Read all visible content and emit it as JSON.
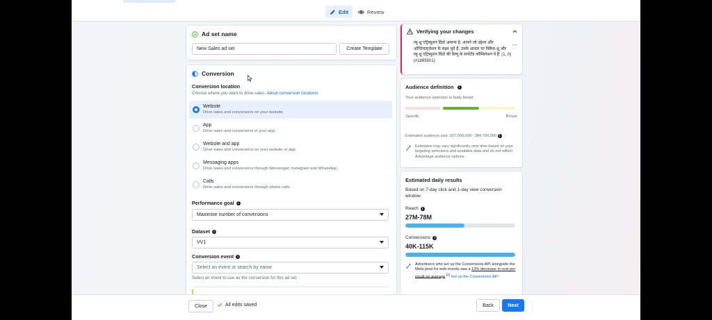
{
  "tabs": {
    "edit": "Edit",
    "review": "Review"
  },
  "ad_set": {
    "title": "Ad set name",
    "name_value": "New Sales ad set",
    "create_template": "Create Template"
  },
  "conversion": {
    "title": "Conversion",
    "location_label": "Conversion location",
    "location_help": "Choose where you want to drive sales.",
    "location_link": "About conversion locations",
    "options": [
      {
        "title": "Website",
        "desc": "Drive sales and conversions on your website."
      },
      {
        "title": "App",
        "desc": "Drive sales and conversions in your app."
      },
      {
        "title": "Website and app",
        "desc": "Drive sales and conversions on your website or app."
      },
      {
        "title": "Messaging apps",
        "desc": "Drive sales and conversions through Messenger, Instagram and WhatsApp."
      },
      {
        "title": "Calls",
        "desc": "Drive sales and conversions through phone calls."
      }
    ],
    "selected_option": "Website",
    "performance_goal_label": "Performance goal",
    "performance_goal_value": "Maximise number of conversions",
    "dataset_label": "Dataset",
    "dataset_value": "VV1",
    "event_label": "Conversion event",
    "event_placeholder": "Select an event or search by name",
    "event_help": "Select an event to use as the conversion for this ad set."
  },
  "verify": {
    "title": "Verifying your changes",
    "message": "व्यू-थ्रू एट्रिब्यूशन विंडो अमान्य है: आपने जो उद्देश्य और ऑप्टिमाइज़ेशन के लक्ष्य चुने हैं, उनके आधार पर क्लिक-थ्रू और व्यू-थ्रू एट्रिब्यूशन विंडो की वैल्यू के सपोर्टेड कॉम्बिनेशन ये हैं: (1, 0) (#1885501)",
    "more": "···",
    "accent": "#e0245e"
  },
  "audience": {
    "title": "Audience definition",
    "status": "Your audience selection is fairly broad.",
    "specific": "Specific",
    "broad": "Broad",
    "size_label": "Estimated audience size: 327,000,000 - 384,700,000",
    "note": "Estimates may vary significantly over time based on your targeting selections and available data and do not reflect Advantage audience options."
  },
  "daily": {
    "title": "Estimated daily results",
    "basis": "Based on 7-day click and 1-day view conversion window",
    "reach_label": "Reach",
    "reach_value": "27M-78M",
    "reach_fill": 0.54,
    "conv_label": "Conversions",
    "conv_value": "40K-115K",
    "conv_fill": 1.0,
    "tip_text": "Advertisers who set up the Conversions API alongside the Meta pixel for web events saw a",
    "tip_link1": "13% decrease in cost per result on average",
    "tip_sup": "[1]",
    "tip_link2": "Set up the Conversions API"
  },
  "footer": {
    "close": "Close",
    "saved": "All edits saved",
    "back": "Back",
    "next": "Next"
  },
  "colors": {
    "primary": "#1877f2",
    "success": "#42b72a",
    "bar": "#4db3e6"
  }
}
